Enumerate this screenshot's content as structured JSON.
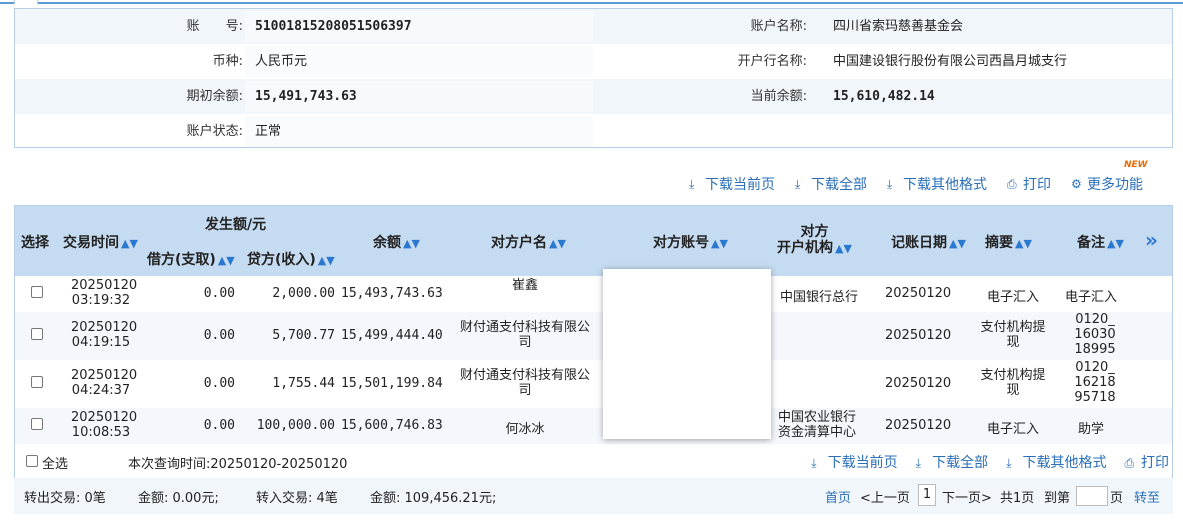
{
  "account": {
    "account_no_label": "账　　号:",
    "account_no": "51001815208051506397",
    "account_name_label": "账户名称:",
    "account_name": "四川省索玛慈善基金会",
    "currency_label": "币种:",
    "currency": "人民币元",
    "bank_label": "开户行名称:",
    "bank": "中国建设银行股份有限公司西昌月城支行",
    "opening_balance_label": "期初余额:",
    "opening_balance": "15,491,743.63",
    "current_balance_label": "当前余额:",
    "current_balance": "15,610,482.14",
    "status_label": "账户状态:",
    "status": "正常"
  },
  "toolbar": {
    "new_badge": "NEW",
    "download_current": "下载当前页",
    "download_all": "下载全部",
    "download_other": "下载其他格式",
    "print": "打印",
    "more": "更多功能"
  },
  "grid": {
    "headers": {
      "select": "选择",
      "time": "交易时间",
      "amount_group": "发生额/元",
      "debit": "借方(支取)",
      "credit": "贷方(收入)",
      "balance": "余额",
      "counterparty_name": "对方户名",
      "counterparty_account": "对方账号",
      "counterparty_bank_1": "对方",
      "counterparty_bank_2": "开户机构",
      "post_date": "记账日期",
      "summary": "摘要",
      "remark": "备注",
      "expand": "»"
    },
    "rows": [
      {
        "date": "20250120",
        "time": "03:19:32",
        "debit": "0.00",
        "credit": "2,000.00",
        "balance": "15,493,743.63",
        "name_1": "崔鑫",
        "name_2": "",
        "bank_1": "中国银行总行",
        "bank_2": "",
        "post_date": "20250120",
        "summary_1": "电子汇入",
        "summary_2": "",
        "remark_1": "电子汇入",
        "remark_2": "",
        "remark_3": ""
      },
      {
        "date": "20250120",
        "time": "04:19:15",
        "debit": "0.00",
        "credit": "5,700.77",
        "balance": "15,499,444.40",
        "name_1": "财付通支付科技有限公",
        "name_2": "司",
        "bank_1": "",
        "bank_2": "",
        "post_date": "20250120",
        "summary_1": "支付机构提",
        "summary_2": "现",
        "remark_1": "0120_",
        "remark_2": "16030",
        "remark_3": "18995"
      },
      {
        "date": "20250120",
        "time": "04:24:37",
        "debit": "0.00",
        "credit": "1,755.44",
        "balance": "15,501,199.84",
        "name_1": "财付通支付科技有限公",
        "name_2": "司",
        "bank_1": "",
        "bank_2": "",
        "post_date": "20250120",
        "summary_1": "支付机构提",
        "summary_2": "现",
        "remark_1": "0120_",
        "remark_2": "16218",
        "remark_3": "95718"
      },
      {
        "date": "20250120",
        "time": "10:08:53",
        "debit": "0.00",
        "credit": "100,000.00",
        "balance": "15,600,746.83",
        "name_1": "何冰冰",
        "name_2": "",
        "bank_1": "中国农业银行",
        "bank_2": "资金清算中心",
        "post_date": "20250120",
        "summary_1": "电子汇入",
        "summary_2": "",
        "remark_1": "助学",
        "remark_2": "",
        "remark_3": ""
      }
    ]
  },
  "footer": {
    "select_all": "全选",
    "query_time": "本次查询时间:20250120-20250120",
    "download_current": "下载当前页",
    "download_all": "下载全部",
    "download_other": "下载其他格式",
    "print": "打印"
  },
  "summary": {
    "out_count": "转出交易: 0笔",
    "out_amount": "金额: 0.00元;",
    "in_count": "转入交易: 4笔",
    "in_amount": "金额: 109,456.21元;",
    "first": "首页",
    "prev": "<上一页",
    "page": "1",
    "next": "下一页>",
    "total": "共1页",
    "goto_label": "到第",
    "page_unit": "页",
    "goto": "转至"
  }
}
